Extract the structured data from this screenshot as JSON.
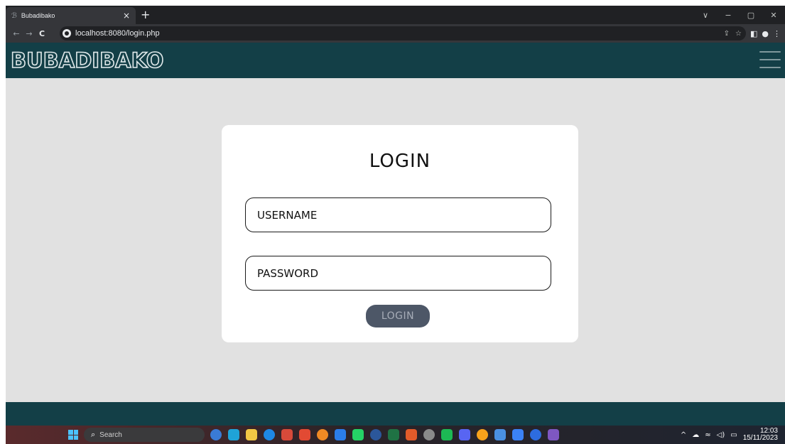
{
  "browser": {
    "tab_title": "Bubadibako",
    "tab_close": "×",
    "new_tab": "+",
    "url": "localhost:8080/login.php",
    "nav": {
      "back": "←",
      "forward": "→",
      "reload": "C"
    },
    "window_controls": [
      "∨",
      "−",
      "▢",
      "✕"
    ],
    "omnibox_icons": [
      "share-icon",
      "star-icon"
    ],
    "toolbar_icons": [
      "sidepanel-icon",
      "profile-icon",
      "menu-icon"
    ]
  },
  "site": {
    "logo": "BUBADIBAKO",
    "header_color": "#133f47",
    "background": "#e1e1e1"
  },
  "login": {
    "title": "LOGIN",
    "username_placeholder": "USERNAME",
    "password_placeholder": "PASSWORD",
    "submit_label": "LOGIN",
    "button_color": "#4d5767"
  },
  "taskbar": {
    "search_label": "Search",
    "app_colors": [
      "#3a7bd5",
      "#1fa3d8",
      "#f2c744",
      "#1e88e5",
      "#d84a3a",
      "#e24a33",
      "#f08a24",
      "#2b7de9",
      "#25d366",
      "#2b579a",
      "#1f7244",
      "#e25b2a",
      "#8a8a8a",
      "#1db954",
      "#5865f2",
      "#f7a21b",
      "#4a90e2",
      "#3b82f6",
      "#2d6cdf",
      "#7e57c2"
    ],
    "clock_time": "12:03",
    "clock_date": "15/11/2023"
  }
}
